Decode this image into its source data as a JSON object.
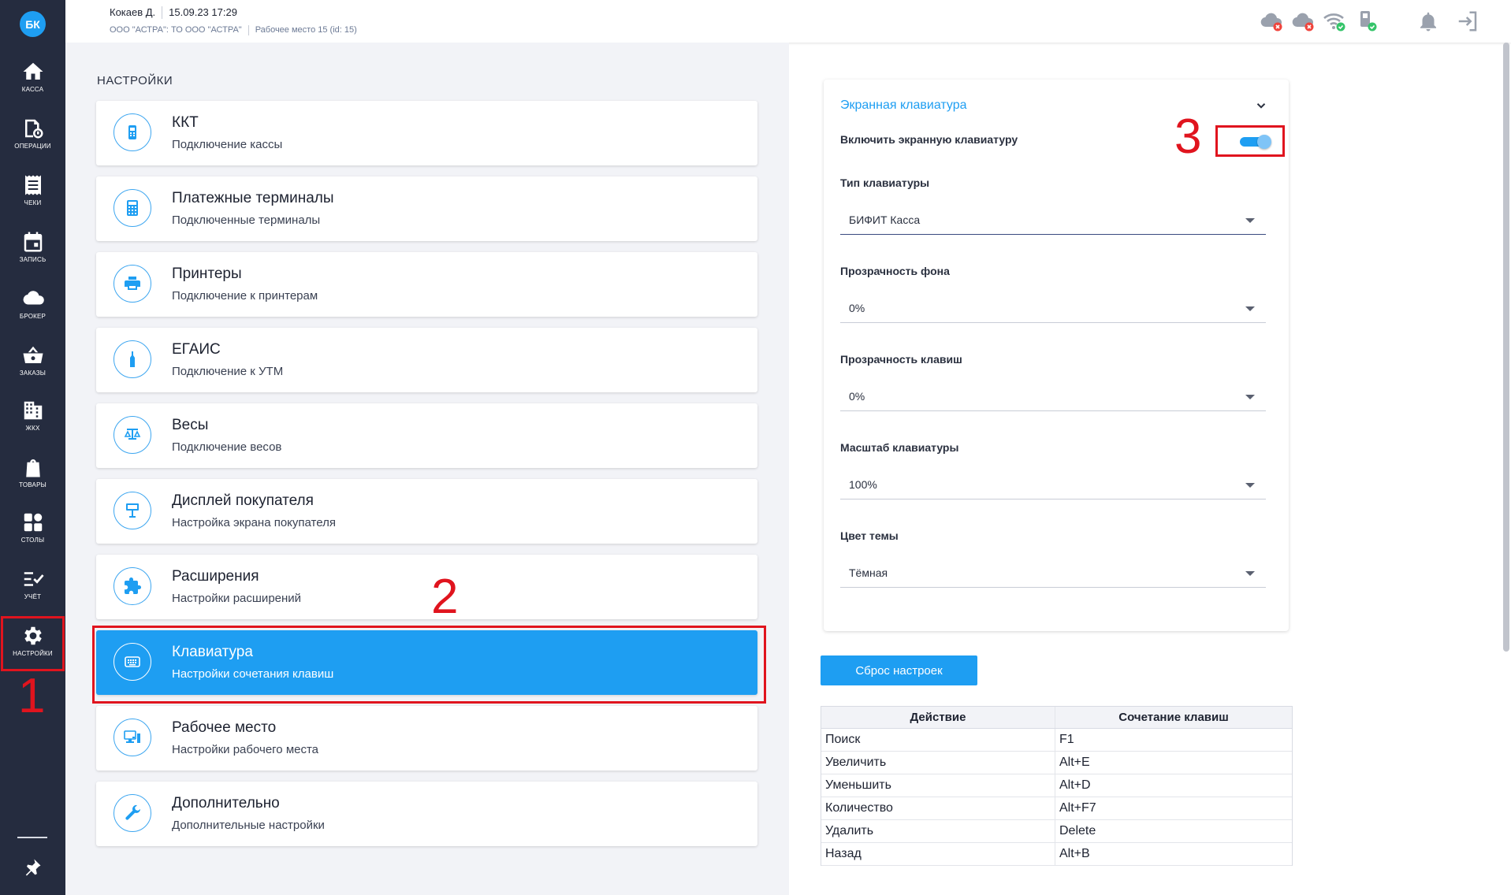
{
  "sidebar": {
    "avatar": "БК",
    "items": [
      {
        "label": "КАССА",
        "icon": "home-icon"
      },
      {
        "label": "ОПЕРАЦИИ",
        "icon": "operations-icon"
      },
      {
        "label": "ЧЕКИ",
        "icon": "receipts-icon"
      },
      {
        "label": "ЗАПИСЬ",
        "icon": "calendar-icon"
      },
      {
        "label": "БРОКЕР",
        "icon": "cloud-icon"
      },
      {
        "label": "ЗАКАЗЫ",
        "icon": "basket-icon"
      },
      {
        "label": "ЖКХ",
        "icon": "building-icon"
      },
      {
        "label": "ТОВАРЫ",
        "icon": "bag-icon"
      },
      {
        "label": "СТОЛЫ",
        "icon": "grid-icon"
      },
      {
        "label": "УЧЁТ",
        "icon": "checklist-icon"
      },
      {
        "label": "НАСТРОЙКИ",
        "icon": "gear-icon"
      }
    ]
  },
  "header": {
    "user": "Кокаев Д.",
    "datetime": "15.09.23 17:29",
    "org": "ООО \"АСТРА\": ТО ООО \"АСТРА\"",
    "workplace": "Рабочее место 15 (id: 15)"
  },
  "settings": {
    "title": "НАСТРОЙКИ",
    "cards": [
      {
        "title": "ККТ",
        "sub": "Подключение кассы",
        "icon": "cash-register-icon"
      },
      {
        "title": "Платежные терминалы",
        "sub": "Подключенные терминалы",
        "icon": "calculator-icon"
      },
      {
        "title": "Принтеры",
        "sub": "Подключение к принтерам",
        "icon": "printer-icon"
      },
      {
        "title": "ЕГАИС",
        "sub": "Подключение к УТМ",
        "icon": "bottle-icon"
      },
      {
        "title": "Весы",
        "sub": "Подключение весов",
        "icon": "scales-icon"
      },
      {
        "title": "Дисплей покупателя",
        "sub": "Настройка экрана покупателя",
        "icon": "display-icon"
      },
      {
        "title": "Расширения",
        "sub": "Настройки расширений",
        "icon": "puzzle-icon"
      },
      {
        "title": "Клавиатура",
        "sub": "Настройки сочетания клавиш",
        "icon": "keyboard-icon"
      },
      {
        "title": "Рабочее место",
        "sub": "Настройки рабочего места",
        "icon": "workplace-icon"
      },
      {
        "title": "Дополнительно",
        "sub": "Дополнительные настройки",
        "icon": "wrench-icon"
      }
    ],
    "active_index": 7
  },
  "keyboard_panel": {
    "title": "Экранная клавиатура",
    "toggle_label": "Включить экранную клавиатуру",
    "toggle_on": true,
    "fields": [
      {
        "label": "Тип клавиатуры",
        "value": "БИФИТ Касса"
      },
      {
        "label": "Прозрачность фона",
        "value": "0%"
      },
      {
        "label": "Прозрачность клавиш",
        "value": "0%"
      },
      {
        "label": "Масштаб клавиатуры",
        "value": "100%"
      },
      {
        "label": "Цвет темы",
        "value": "Тёмная"
      }
    ],
    "reset_label": "Сброс настроек"
  },
  "shortcuts": {
    "headers": [
      "Действие",
      "Сочетание клавиш"
    ],
    "rows": [
      [
        "Поиск",
        "F1"
      ],
      [
        "Увеличить",
        "Alt+E"
      ],
      [
        "Уменьшить",
        "Alt+D"
      ],
      [
        "Количество",
        "Alt+F7"
      ],
      [
        "Удалить",
        "Delete"
      ],
      [
        "Назад",
        "Alt+B"
      ]
    ]
  },
  "annotations": [
    "1",
    "2",
    "3"
  ],
  "colors": {
    "accent": "#1e9ef2",
    "sidebar": "#252c3f",
    "annotation": "#e0141e"
  }
}
